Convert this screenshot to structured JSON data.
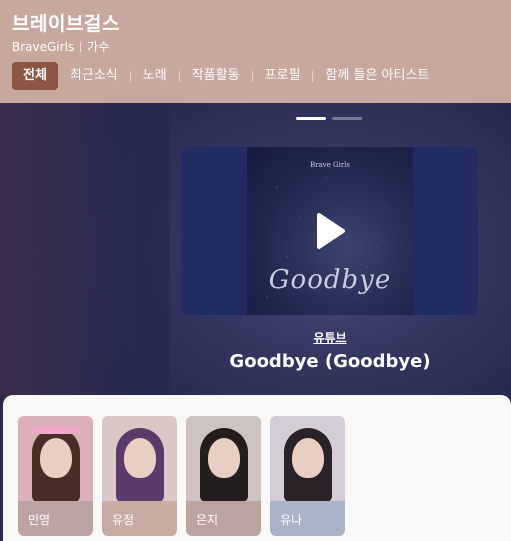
{
  "artist": {
    "title": "브레이브걸스",
    "english_name": "BraveGirls",
    "role": "가수"
  },
  "tabs": [
    {
      "label": "전체",
      "active": true
    },
    {
      "label": "최근소식",
      "active": false
    },
    {
      "label": "노래",
      "active": false
    },
    {
      "label": "작품활동",
      "active": false
    },
    {
      "label": "프로필",
      "active": false
    },
    {
      "label": "함께 들은 아티스트",
      "active": false
    }
  ],
  "carousel": {
    "pages": 2,
    "current": 1
  },
  "video": {
    "cover_artist": "Brave Girls",
    "cover_title": "Goodbye",
    "source": "유튜브",
    "song_title": "Goodbye (Goodbye)",
    "play_icon": "play-icon"
  },
  "members": [
    {
      "name": "민영",
      "color": "#bda4a3"
    },
    {
      "name": "유정",
      "color": "#c8aca3"
    },
    {
      "name": "은지",
      "color": "#bca3a0"
    },
    {
      "name": "유나",
      "color": "#a9b4c9"
    }
  ],
  "colors": {
    "header_bg": "#c7a79e",
    "active_tab": "#8e5444"
  }
}
